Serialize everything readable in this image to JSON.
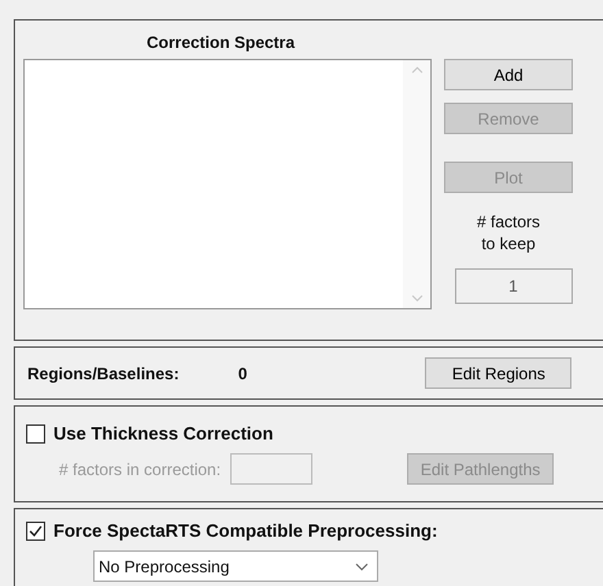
{
  "correction_spectra": {
    "title": "Correction Spectra",
    "buttons": [
      {
        "label": "Add",
        "disabled": false
      },
      {
        "label": "Remove",
        "disabled": true
      },
      {
        "label": "Plot",
        "disabled": true
      }
    ],
    "factors_label": "# factors to keep",
    "factors_value": "1"
  },
  "regions": {
    "label": "Regions/Baselines:",
    "count": "0",
    "button": {
      "label": "Edit Regions",
      "disabled": false
    }
  },
  "thickness": {
    "label": "Use Thickness Correction",
    "checked": false,
    "factors_label": "# factors in correction:",
    "disabled": true,
    "button": {
      "label": "Edit Pathlengths",
      "disabled": true
    }
  },
  "preprocessing": {
    "label": "Force SpectaRTS Compatible Preprocessing:",
    "checked": true,
    "value": "No Preprocessing"
  }
}
